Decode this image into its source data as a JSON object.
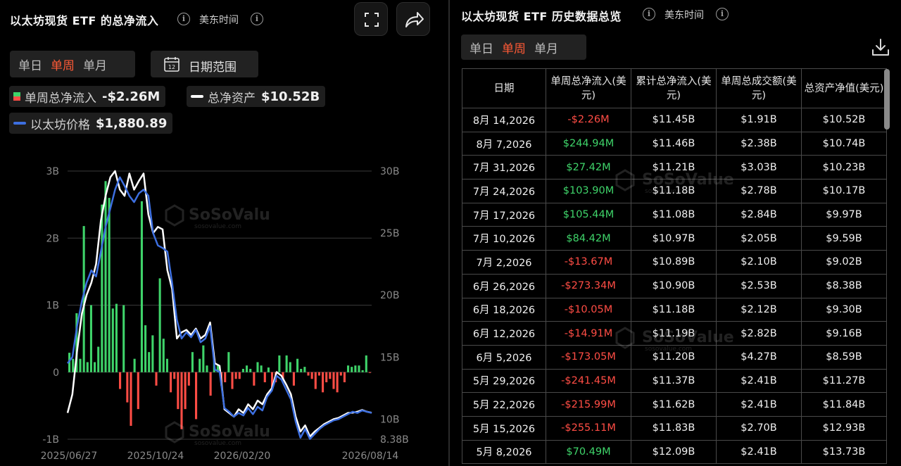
{
  "left_panel": {
    "title": "以太坊现货 ETF 的总净流入",
    "timezone": "美东时间",
    "period_tabs": [
      "单日",
      "单周",
      "单月"
    ],
    "active_period": "单周",
    "date_range_label": "日期范围",
    "calendar_day": "12",
    "legend": {
      "net_flow_label": "单周总净流入",
      "net_flow_value": "-$2.26M",
      "net_assets_label": "总净资产",
      "net_assets_value": "$10.52B",
      "price_label": "以太坊价格",
      "price_value": "$1,880.89"
    },
    "watermark": {
      "brand": "SoSoValue",
      "site": "sosovalue.com"
    }
  },
  "right_panel": {
    "title": "以太坊现货 ETF 历史数据总览",
    "timezone": "美东时间",
    "period_tabs": [
      "单日",
      "单周",
      "单月"
    ],
    "active_period": "单周",
    "columns": [
      "日期",
      "单周总净流入(美元)",
      "累计总净流入(美元)",
      "单周总成交额(美元)",
      "总资产净值(美元)"
    ],
    "rows": [
      [
        "8月 14,2026",
        "-$2.26M",
        "$11.45B",
        "$1.91B",
        "$10.52B"
      ],
      [
        "8月 7,2026",
        "$244.94M",
        "$11.46B",
        "$2.38B",
        "$10.74B"
      ],
      [
        "7月 31,2026",
        "$27.42M",
        "$11.21B",
        "$3.03B",
        "$10.23B"
      ],
      [
        "7月 24,2026",
        "$103.90M",
        "$11.18B",
        "$2.78B",
        "$10.17B"
      ],
      [
        "7月 17,2026",
        "$105.44M",
        "$11.08B",
        "$2.84B",
        "$9.97B"
      ],
      [
        "7月 10,2026",
        "$84.42M",
        "$10.97B",
        "$2.05B",
        "$9.59B"
      ],
      [
        "7月 2,2026",
        "-$13.67M",
        "$10.89B",
        "$2.10B",
        "$9.02B"
      ],
      [
        "6月 26,2026",
        "-$273.34M",
        "$10.90B",
        "$2.53B",
        "$8.38B"
      ],
      [
        "6月 18,2026",
        "-$10.05M",
        "$11.18B",
        "$2.12B",
        "$9.30B"
      ],
      [
        "6月 12,2026",
        "-$14.91M",
        "$11.19B",
        "$2.82B",
        "$9.16B"
      ],
      [
        "6月 5,2026",
        "-$173.05M",
        "$11.20B",
        "$4.27B",
        "$8.59B"
      ],
      [
        "5月 29,2026",
        "-$241.45M",
        "$11.37B",
        "$2.41B",
        "$11.27B"
      ],
      [
        "5月 22,2026",
        "-$215.99M",
        "$11.62B",
        "$2.41B",
        "$11.84B"
      ],
      [
        "5月 15,2026",
        "-$255.11M",
        "$11.83B",
        "$2.70B",
        "$12.93B"
      ],
      [
        "5月 8,2026",
        "$70.49M",
        "$12.09B",
        "$2.41B",
        "$13.73B"
      ]
    ]
  },
  "colors": {
    "positive": "#3fd46a",
    "negative": "#ff4d45",
    "price_line": "#3d6fe0",
    "assets_line": "#ffffff",
    "accent": "#ff5a36"
  },
  "chart_data": {
    "type": "bar",
    "x_tick_labels": [
      "2025/06/27",
      "2025/10/24",
      "2026/02/20",
      "2026/08/14"
    ],
    "left_axis": {
      "label": "",
      "ticks": [
        "-1B",
        "0",
        "1B",
        "2B",
        "3B"
      ],
      "ylim": [
        -1.0,
        3.0
      ],
      "unit": "USD"
    },
    "right_axis": {
      "label": "",
      "ticks": [
        "8.38B",
        "10B",
        "15B",
        "20B",
        "25B",
        "30B"
      ],
      "ylim": [
        8.38,
        30.0
      ],
      "unit": "USD B"
    },
    "series": [
      {
        "name": "单周总净流入",
        "type": "bar",
        "axis": "left",
        "values": [
          0.29,
          0.2,
          0.88,
          0.2,
          2.18,
          0.15,
          1.0,
          0.15,
          0.38,
          2.5,
          2.85,
          2.6,
          0.95,
          1.02,
          -0.25,
          1.0,
          -0.45,
          -0.8,
          0.2,
          -0.55,
          2.55,
          0.7,
          0.3,
          0.55,
          -0.2,
          1.4,
          0.5,
          0.2,
          -0.3,
          -0.1,
          -0.55,
          -0.85,
          -0.55,
          -0.2,
          0.3,
          -0.7,
          0.2,
          0.4,
          0.1,
          -0.35,
          0.2,
          0.1,
          -0.2,
          -0.15,
          0.3,
          -0.25,
          -0.1,
          -0.1,
          0.05,
          0.1,
          0.05,
          -0.2,
          0.15,
          0.1,
          -0.15,
          0.07,
          -0.25,
          -0.15,
          0.25,
          -0.1,
          0.25,
          0.15,
          -0.2,
          0.2,
          0.05,
          0.08,
          -0.05,
          -0.1,
          -0.25,
          -0.05,
          -0.3,
          -0.15,
          -0.1,
          -0.25,
          -0.3,
          -0.05,
          -0.15,
          0.1,
          0.08,
          0.1,
          0.1,
          0.03,
          0.25,
          -0.002
        ]
      },
      {
        "name": "总净资产",
        "type": "line",
        "axis": "right",
        "values": [
          10.5,
          12.0,
          15.5,
          18.5,
          20.0,
          21.0,
          22.5,
          26.0,
          28.0,
          29.5,
          30.0,
          28.5,
          28.0,
          29.8,
          28.5,
          29.2,
          29.8,
          26.5,
          25.0,
          25.5,
          25.3,
          22.0,
          20.5,
          16.5,
          17.0,
          17.2,
          16.8,
          17.3,
          16.5,
          16.8,
          17.8,
          14.5,
          14.3,
          10.8,
          10.5,
          10.2,
          10.8,
          10.5,
          11.2,
          10.8,
          11.5,
          11.2,
          12.0,
          12.5,
          13.8,
          13.5,
          12.8,
          12.0,
          10.2,
          9.0,
          9.5,
          8.6,
          9.0,
          9.3,
          9.6,
          9.8,
          10.0,
          10.1,
          10.3,
          10.5,
          10.52,
          10.6,
          10.74,
          10.6,
          10.52
        ]
      },
      {
        "name": "以太坊价格",
        "type": "line",
        "axis": "right",
        "values": [
          14.5,
          15.0,
          17.5,
          19.5,
          21.0,
          22.0,
          21.5,
          23.5,
          25.5,
          27.0,
          28.5,
          29.5,
          28.8,
          28.0,
          27.5,
          28.2,
          28.5,
          28.0,
          25.0,
          24.0,
          23.8,
          23.5,
          21.0,
          18.0,
          16.5,
          17.0,
          16.6,
          17.2,
          16.2,
          16.5,
          17.5,
          14.0,
          13.8,
          10.9,
          10.6,
          10.2,
          10.5,
          10.3,
          10.9,
          10.4,
          11.0,
          10.7,
          11.8,
          12.3,
          13.5,
          13.2,
          12.4,
          11.6,
          9.8,
          8.5,
          9.2,
          8.4,
          8.8,
          9.2,
          9.5,
          9.7,
          9.9,
          10.0,
          10.2,
          10.4,
          10.6,
          10.5,
          10.7,
          10.6,
          10.5
        ]
      }
    ],
    "legend_position": "top-left",
    "grid": true
  }
}
